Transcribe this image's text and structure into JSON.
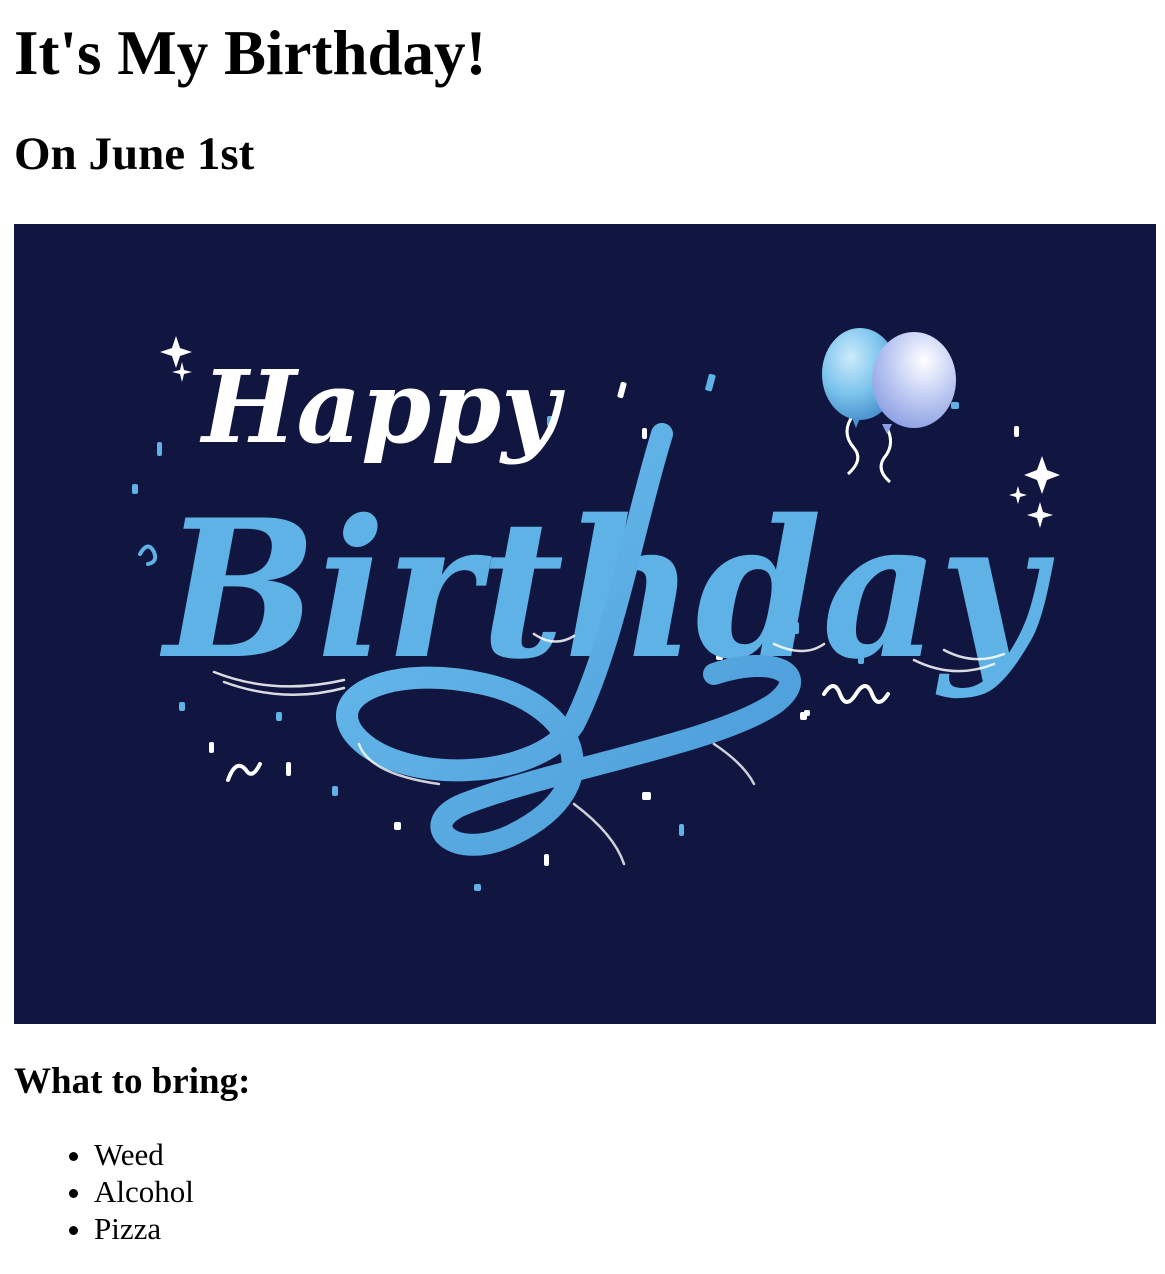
{
  "page": {
    "title": "It's My Birthday!",
    "date": "On June 1st"
  },
  "banner": {
    "word_1": "Happy",
    "word_2": "Birthday",
    "colors": {
      "background": "#111640",
      "script_white": "#ffffff",
      "script_blue": "#5fb2e6",
      "balloon_blue": "#7fc6ee",
      "balloon_lavender": "#b9c7f2"
    }
  },
  "bring": {
    "heading": "What to bring:",
    "items": [
      "Weed",
      "Alcohol",
      "Pizza"
    ]
  }
}
